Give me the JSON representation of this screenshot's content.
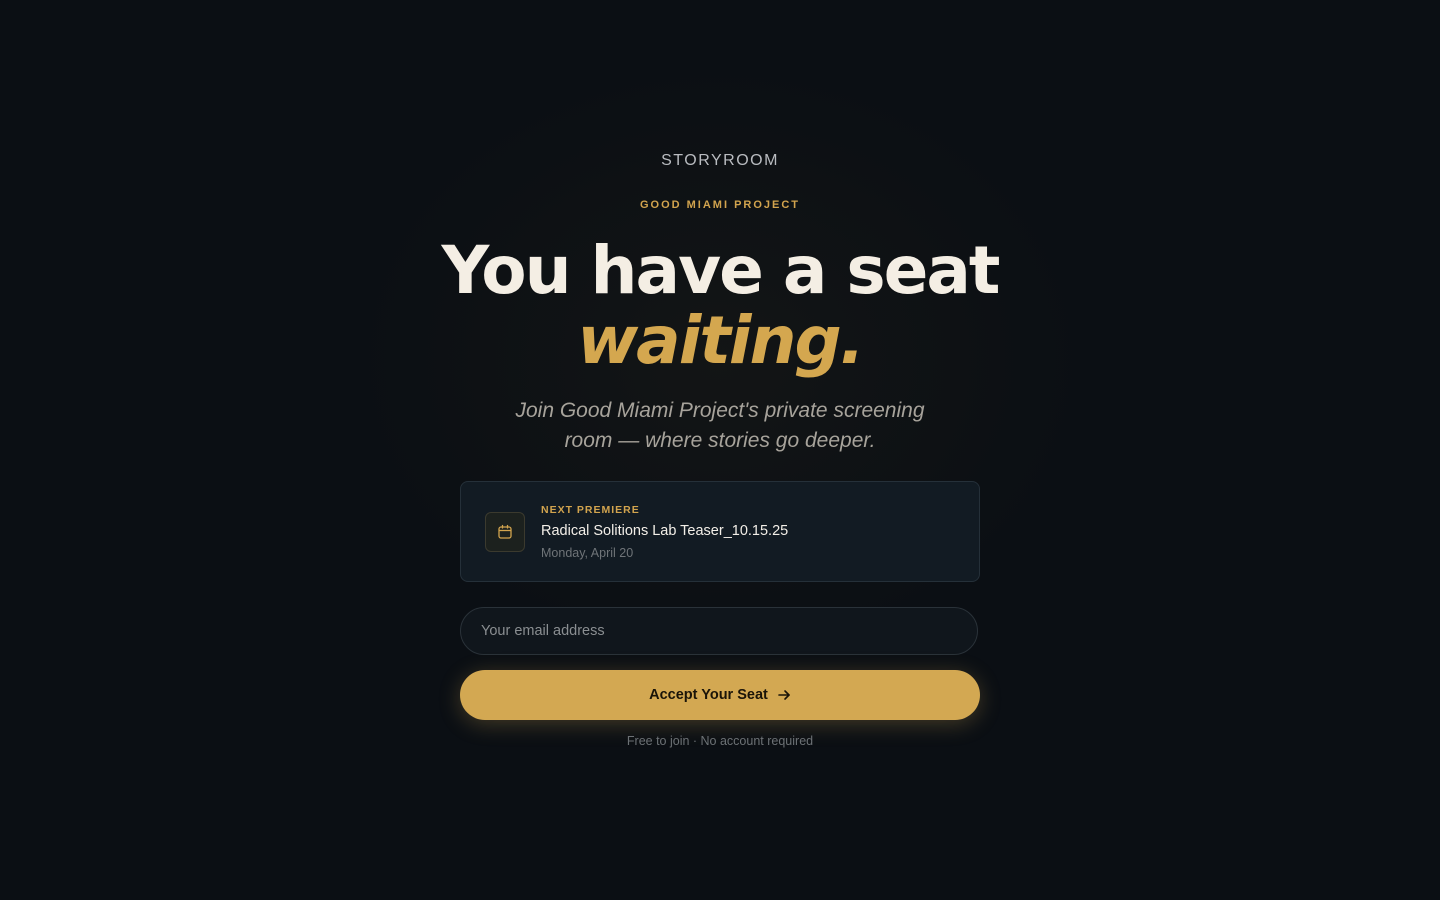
{
  "brand": {
    "name": "STORYROOM"
  },
  "invite": {
    "org_name": "GOOD MIAMI PROJECT",
    "headline": "You have a seat",
    "headline_accent": "waiting.",
    "subtitle": "Join Good Miami Project's private screening room — where stories go deeper."
  },
  "premiere": {
    "label": "NEXT PREMIERE",
    "title": "Radical Solitions Lab Teaser_10.15.25",
    "date": "Monday, April 20",
    "icon": "calendar-icon"
  },
  "form": {
    "email_placeholder": "Your email address",
    "email_value": "",
    "submit_label": "Accept Your Seat",
    "submit_icon": "arrow-right-icon",
    "footnote": "Free to join · No account required"
  },
  "colors": {
    "background": "#0b0f14",
    "accent": "#d3a852",
    "card": "#121b23",
    "headline": "#f4eee4"
  }
}
